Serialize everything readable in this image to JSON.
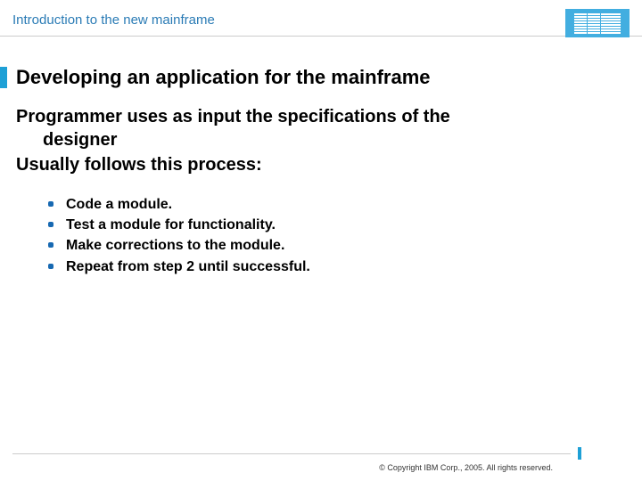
{
  "header": {
    "title": "Introduction to the new mainframe",
    "logo_name": "ibm-logo"
  },
  "slide": {
    "title": "Developing an application for the mainframe"
  },
  "intro": {
    "line1a": "Programmer uses as input the specifications of the",
    "line1b": "designer",
    "line2": "Usually follows this process:"
  },
  "bullets": {
    "b1": "Code a module.",
    "b2": "Test a module for functionality.",
    "b3": "Make corrections to the module.",
    "b4": "Repeat from step 2 until successful."
  },
  "footer": {
    "copyright": "© Copyright IBM Corp., 2005. All rights reserved."
  },
  "colors": {
    "accent": "#1ea0d6",
    "header_box": "#42aee0",
    "bullet": "#1769b2"
  }
}
